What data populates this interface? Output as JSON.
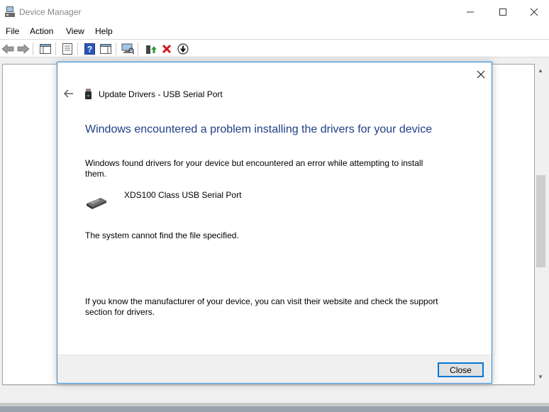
{
  "window": {
    "title": "Device Manager",
    "icon": "device-manager-icon"
  },
  "menu": {
    "items": [
      {
        "label": "File"
      },
      {
        "label": "Action"
      },
      {
        "label": "View"
      },
      {
        "label": "Help"
      }
    ]
  },
  "toolbar": {
    "icons": [
      "back-icon",
      "forward-icon",
      "show-hide-tree-icon",
      "properties-icon",
      "help-icon",
      "action-pane-icon",
      "scan-hardware-icon",
      "update-driver-icon",
      "uninstall-icon",
      "disable-icon"
    ]
  },
  "dialog": {
    "header": "Update Drivers - USB Serial Port",
    "heading": "Windows encountered a problem installing the drivers for your device",
    "description": "Windows found drivers for your device but encountered an error while attempting to install them.",
    "device_name": "XDS100 Class USB Serial Port",
    "error_message": "The system cannot find the file specified.",
    "help_text": "If you know the manufacturer of your device, you can visit their website and check the support section for drivers.",
    "close_button": "Close"
  },
  "colors": {
    "heading": "#1f3f86",
    "dialog_border": "#2b8ad4",
    "uninstall_red": "#d4161f"
  }
}
